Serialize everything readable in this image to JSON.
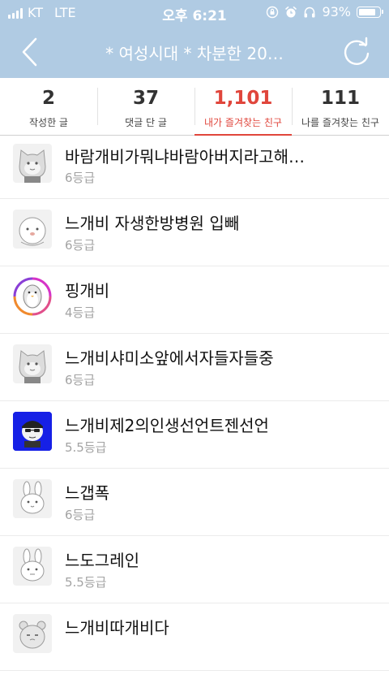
{
  "status_bar": {
    "carrier": "KT",
    "network": "LTE",
    "time": "오후 6:21",
    "battery_percent": "93%",
    "battery_level": 0.93,
    "icons": [
      "orientation-lock-icon",
      "alarm-icon",
      "headphones-icon",
      "battery-icon"
    ]
  },
  "nav": {
    "title": "* 여성시대 *  차분한 20…",
    "back_icon": "chevron-left-icon",
    "refresh_icon": "refresh-icon"
  },
  "stats": [
    {
      "value": "2",
      "label": "작성한 글"
    },
    {
      "value": "37",
      "label": "댓글 단 글"
    },
    {
      "value": "1,101",
      "label": "내가 즐겨찾는 친구",
      "active": true
    },
    {
      "value": "111",
      "label": "나를 즐겨찾는 친구"
    }
  ],
  "colors": {
    "header": "#b0cbe3",
    "active": "#e0463c",
    "grade": "#a3a3a3"
  },
  "friends": [
    {
      "name": "바람개비가뭐냐바람아버지라고해…",
      "grade": "6등급",
      "avatar": "cat-character-avatar"
    },
    {
      "name": "느개비 자생한방병원 입빼",
      "grade": "6등급",
      "avatar": "round-character-avatar"
    },
    {
      "name": "핑개비",
      "grade": "4등급",
      "avatar": "penguin-ring-avatar"
    },
    {
      "name": "느개비샤미소앞에서자들자들중",
      "grade": "6등급",
      "avatar": "cat-character-avatar"
    },
    {
      "name": "느개비제2의인생선언트젠선언",
      "grade": "5.5등급",
      "avatar": "blue-character-avatar"
    },
    {
      "name": "느갭폭",
      "grade": "6등급",
      "avatar": "rabbit-character-avatar"
    },
    {
      "name": "느도그레인",
      "grade": "5.5등급",
      "avatar": "rabbit-character-avatar"
    },
    {
      "name": "느개비따개비다",
      "grade": "",
      "avatar": "bear-character-avatar"
    }
  ]
}
